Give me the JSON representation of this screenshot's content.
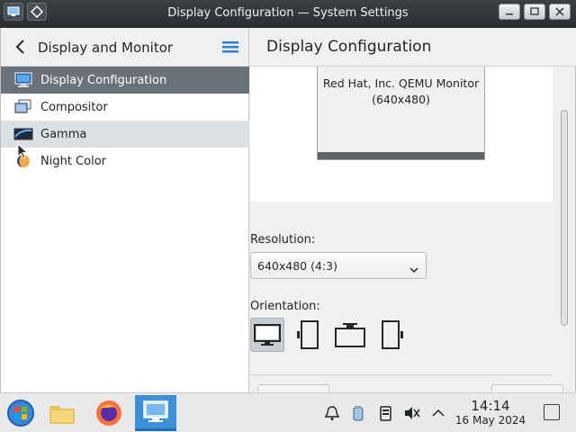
{
  "window": {
    "title": "Display Configuration — System Settings"
  },
  "sidebar": {
    "title": "Display and Monitor",
    "items": [
      {
        "label": "Display Configuration",
        "icon": "display-config-icon",
        "state": "selected"
      },
      {
        "label": "Compositor",
        "icon": "compositor-icon",
        "state": "normal"
      },
      {
        "label": "Gamma",
        "icon": "gamma-icon",
        "state": "hover"
      },
      {
        "label": "Night Color",
        "icon": "night-color-icon",
        "state": "normal"
      }
    ]
  },
  "main": {
    "title": "Display Configuration",
    "monitor": {
      "name": "Red Hat, Inc. QEMU Monitor",
      "resolution_text": "(640x480)"
    },
    "resolution": {
      "label": "Resolution:",
      "value": "640x480 (4:3)"
    },
    "orientation": {
      "label": "Orientation:",
      "options": [
        "landscape",
        "portrait-left",
        "landscape-flipped",
        "portrait-right"
      ],
      "selected": "landscape"
    }
  },
  "taskbar": {
    "apps": [
      "start-menu",
      "file-manager",
      "firefox",
      "system-settings"
    ],
    "active_app": "system-settings",
    "tray": [
      "notifications-icon",
      "clipboard-icon",
      "device-icon",
      "volume-muted-icon",
      "expand-tray-icon"
    ],
    "clock": {
      "time": "14:14",
      "date": "16 May 2024"
    }
  },
  "colors": {
    "selected_bg": "#6b7178",
    "accent": "#3d8fd8",
    "window_bg": "#eff0f1"
  }
}
